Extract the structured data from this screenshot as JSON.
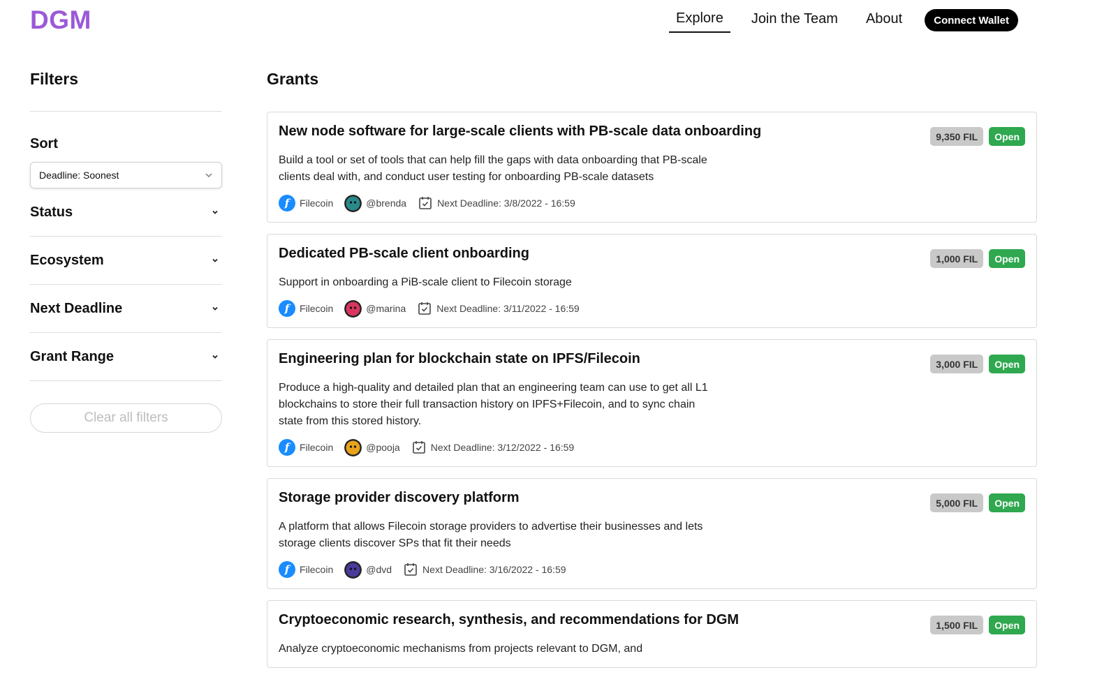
{
  "header": {
    "logo": "DGM",
    "nav": [
      {
        "label": "Explore",
        "active": true
      },
      {
        "label": "Join the Team",
        "active": false
      },
      {
        "label": "About",
        "active": false
      }
    ],
    "connect_label": "Connect Wallet"
  },
  "sidebar": {
    "title": "Filters",
    "sort_label": "Sort",
    "sort_value": "Deadline: Soonest",
    "sections": [
      "Status",
      "Ecosystem",
      "Next Deadline",
      "Grant Range"
    ],
    "clear_label": "Clear all filters"
  },
  "main": {
    "title": "Grants",
    "grants": [
      {
        "title": "New node software for large-scale clients with PB-scale data onboarding",
        "description": "Build a tool or set of tools that can help fill the gaps with data onboarding that PB-scale clients deal with, and conduct user testing for onboarding PB-scale datasets",
        "amount": "9,350 FIL",
        "status": "Open",
        "ecosystem": "Filecoin",
        "author": "@brenda",
        "deadline": "Next Deadline: 3/8/2022 - 16:59",
        "avatar_color": "#2a8a8a"
      },
      {
        "title": "Dedicated PB-scale client onboarding",
        "description": "Support in onboarding a PiB-scale client to Filecoin storage",
        "amount": "1,000 FIL",
        "status": "Open",
        "ecosystem": "Filecoin",
        "author": "@marina",
        "deadline": "Next Deadline: 3/11/2022 - 16:59",
        "avatar_color": "#d8365f"
      },
      {
        "title": "Engineering plan for blockchain state on IPFS/Filecoin",
        "description": "Produce a high-quality and detailed plan that an engineering team can use to get all L1 blockchains to store their full transaction history on IPFS+Filecoin, and to sync chain state from this stored history.",
        "amount": "3,000 FIL",
        "status": "Open",
        "ecosystem": "Filecoin",
        "author": "@pooja",
        "deadline": "Next Deadline: 3/12/2022 - 16:59",
        "avatar_color": "#e8a21c"
      },
      {
        "title": "Storage provider discovery platform",
        "description": "A platform that allows Filecoin storage providers to advertise their businesses and lets storage clients discover SPs that fit their needs",
        "amount": "5,000 FIL",
        "status": "Open",
        "ecosystem": "Filecoin",
        "author": "@dvd",
        "deadline": "Next Deadline: 3/16/2022 - 16:59",
        "avatar_color": "#4a3a9a"
      },
      {
        "title": "Cryptoeconomic research, synthesis, and recommendations for DGM",
        "description": "Analyze cryptoeconomic mechanisms from projects relevant to DGM, and",
        "amount": "1,500 FIL",
        "status": "Open",
        "ecosystem": "",
        "author": "",
        "deadline": "",
        "avatar_color": "#888888"
      }
    ]
  },
  "colors": {
    "logo": "#9b59d8",
    "open_badge": "#2fa84f",
    "amount_badge": "#c9c9c9",
    "filecoin_icon": "#1a8cff"
  },
  "icons": [
    "chevron-down-icon",
    "filecoin-icon",
    "calendar-check-icon"
  ]
}
